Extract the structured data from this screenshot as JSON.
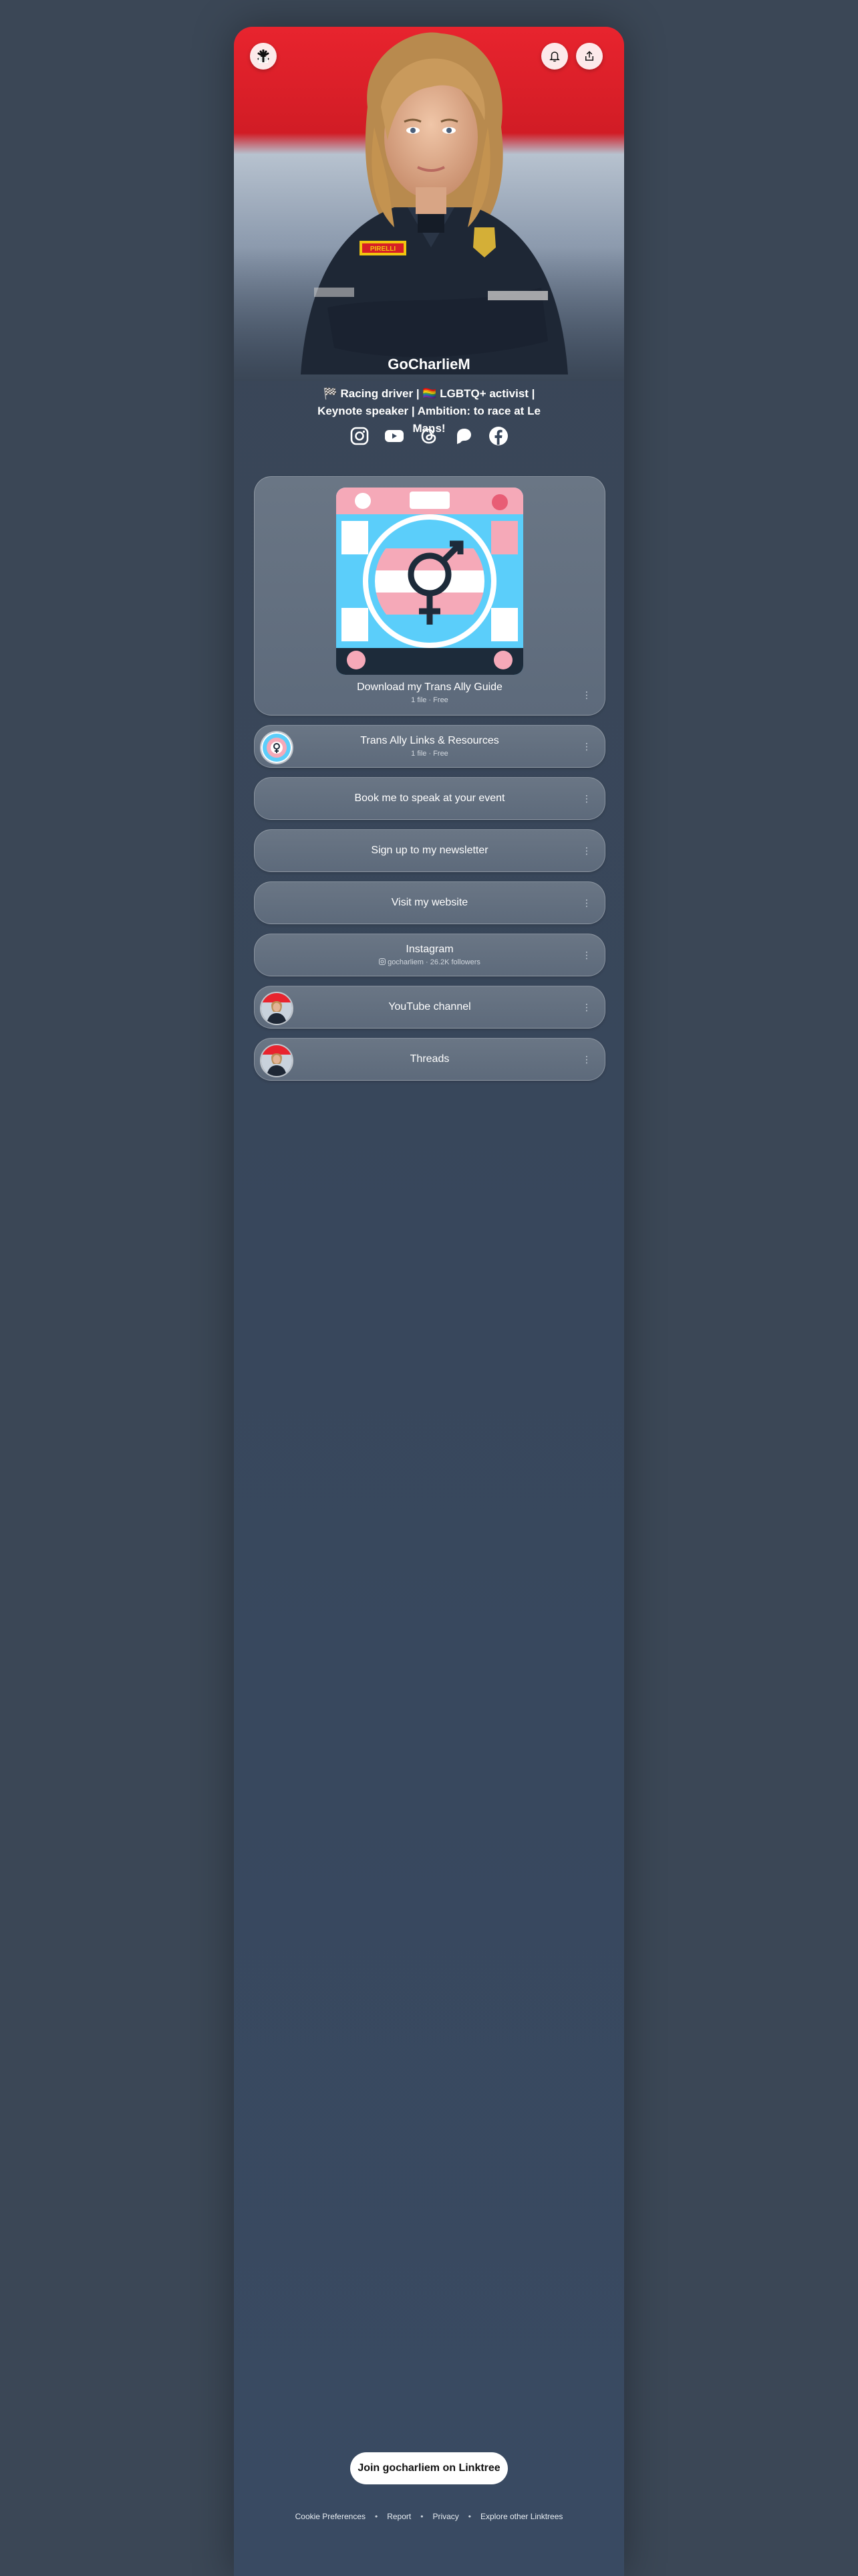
{
  "profile": {
    "name": "GoCharlieM",
    "bio": "🏁 Racing driver | 🏳️‍🌈 LGBTQ+ activist | Keynote speaker | Ambition: to race at Le Mans!"
  },
  "header": {
    "logo_icon": "linktree-logo-icon",
    "bell_icon": "bell-icon",
    "share_icon": "share-icon"
  },
  "socials": [
    "instagram-icon",
    "youtube-icon",
    "threads-icon",
    "patreon-icon",
    "facebook-icon"
  ],
  "featured": {
    "title": "Download my Trans Ally Guide",
    "meta": "1 file · Free"
  },
  "links": [
    {
      "title": "Trans Ally Links & Resources",
      "meta": "1 file · Free",
      "thumb": "trans-flag-thumb"
    },
    {
      "title": "Book me to speak at your event",
      "meta": ""
    },
    {
      "title": "Sign up to my newsletter",
      "meta": ""
    },
    {
      "title": "Visit my website",
      "meta": ""
    },
    {
      "title": "Instagram",
      "meta": "gocharliem · 26.2K followers"
    },
    {
      "title": "YouTube channel",
      "meta": "",
      "thumb": "profile-thumb"
    },
    {
      "title": "Threads",
      "meta": "",
      "thumb": "profile-thumb"
    }
  ],
  "cta": {
    "join_label": "Join gocharliem on Linktree"
  },
  "footer": {
    "items": [
      "Cookie Preferences",
      "Report",
      "Privacy",
      "Explore other Linktrees"
    ]
  },
  "colors": {
    "page_bg": "#3b4756",
    "card_bg": "#647183",
    "hero_red": "#e8242e",
    "trans_blue": "#5bcefa",
    "trans_pink": "#f5a9b8"
  }
}
